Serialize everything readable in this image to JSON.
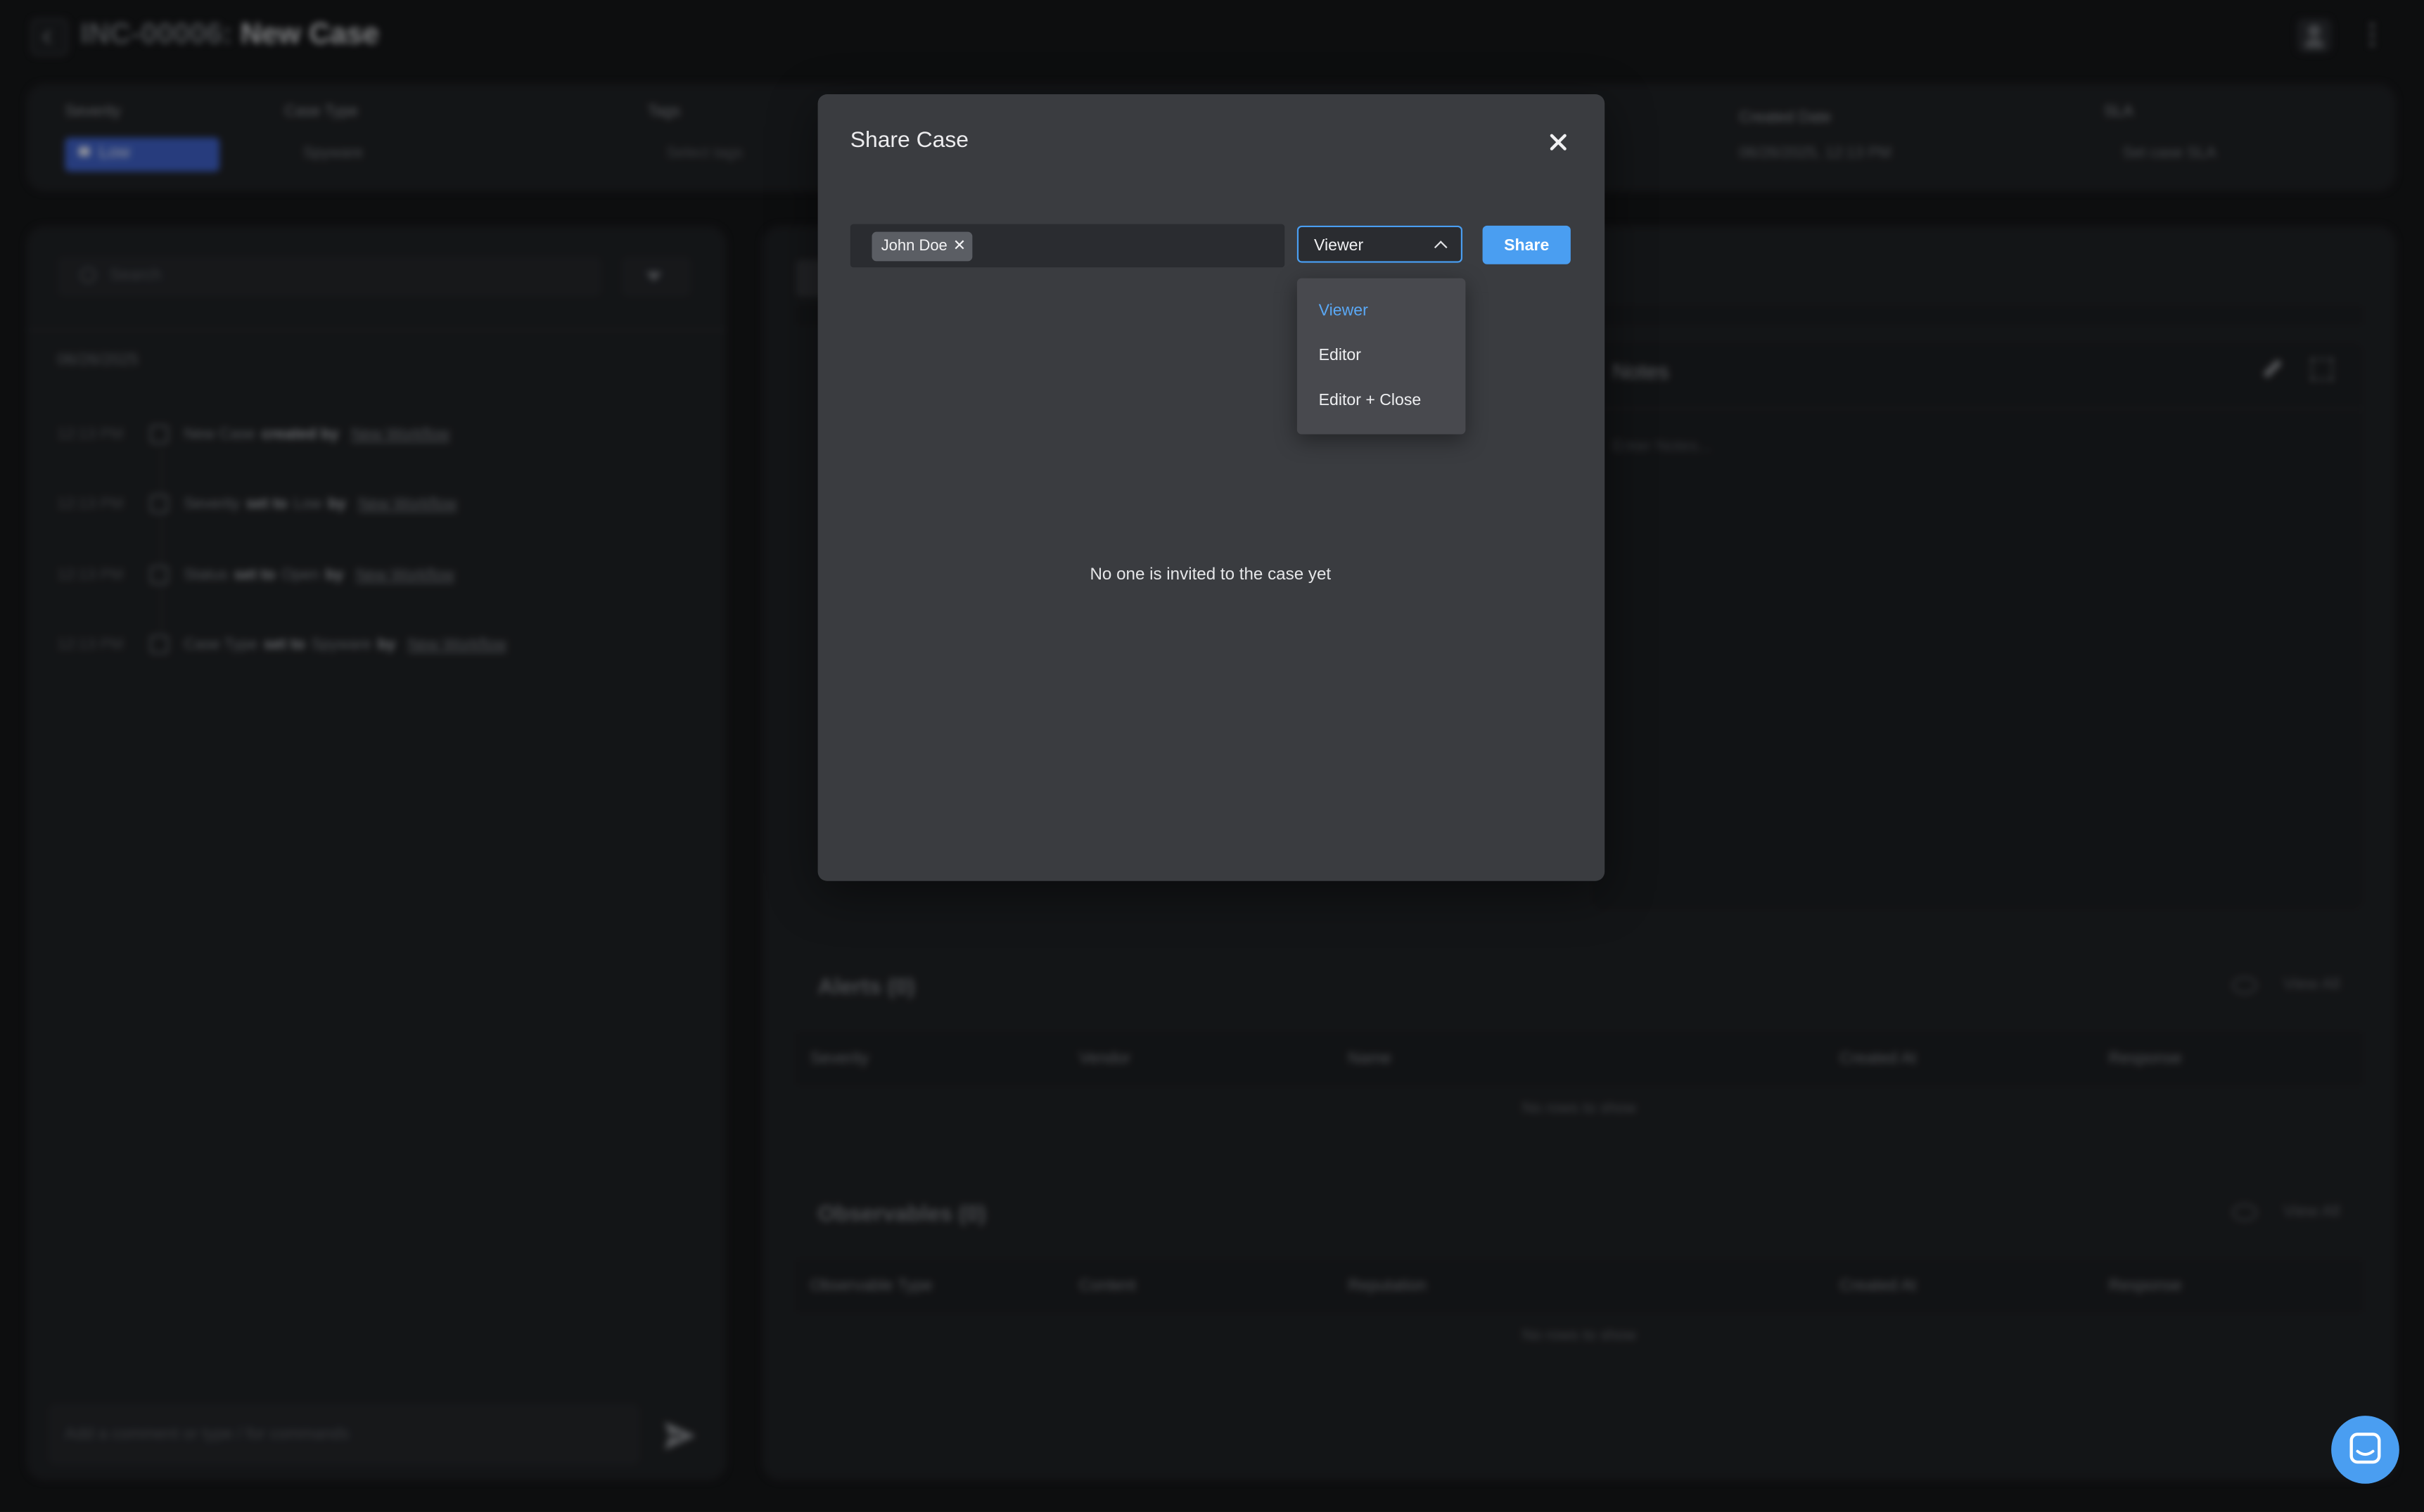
{
  "header": {
    "case_id": "INC-00006:",
    "case_name": "New Case"
  },
  "summary": {
    "severity_label": "Severity",
    "severity_value": "Low",
    "case_type_label": "Case Type",
    "case_type_value": "Spyware",
    "tags_label": "Tags",
    "tags_placeholder": "Select tags",
    "created_label": "Created Date",
    "created_value": "06/26/2025, 12:13 PM",
    "sla_label": "SLA",
    "sla_value": "Set case SLA"
  },
  "timeline": {
    "search_placeholder": "Search",
    "date": "06/26/2025",
    "items": [
      {
        "time": "12:13 PM",
        "a": "New Case",
        "verb": "created by",
        "b": "",
        "by": "",
        "actor": "New Workflow"
      },
      {
        "time": "12:13 PM",
        "a": "Severity",
        "verb": "set to",
        "b": "Low",
        "by": "by",
        "actor": "New Workflow"
      },
      {
        "time": "12:13 PM",
        "a": "Status",
        "verb": "set to",
        "b": "Open",
        "by": "by",
        "actor": "New Workflow"
      },
      {
        "time": "12:13 PM",
        "a": "Case Type",
        "verb": "set to",
        "b": "Spyware",
        "by": "by",
        "actor": "New Workflow"
      }
    ],
    "comment_placeholder": "Add a comment or type / for commands"
  },
  "notes": {
    "title": "Notes",
    "placeholder": "Enter Notes..."
  },
  "alerts": {
    "title": "Alerts (0)",
    "view_all": "View All",
    "columns": [
      "Severity",
      "Vendor",
      "Name",
      "Created At",
      "Response"
    ],
    "empty": "No rows to show"
  },
  "observables": {
    "title": "Observables (0)",
    "view_all": "View All",
    "columns": [
      "Observable Type",
      "Content",
      "Reputation",
      "Created At",
      "Response"
    ],
    "empty": "No rows to show"
  },
  "modal": {
    "title": "Share Case",
    "invitee": "John Doe",
    "role_value": "Viewer",
    "share_label": "Share",
    "empty_text": "No one is invited to the case yet",
    "role_options": [
      "Viewer",
      "Editor",
      "Editor + Close"
    ]
  },
  "colors": {
    "accent": "#4a9ef1",
    "modal_bg": "#3a3c40",
    "severity_low": "#3d5fc4"
  }
}
